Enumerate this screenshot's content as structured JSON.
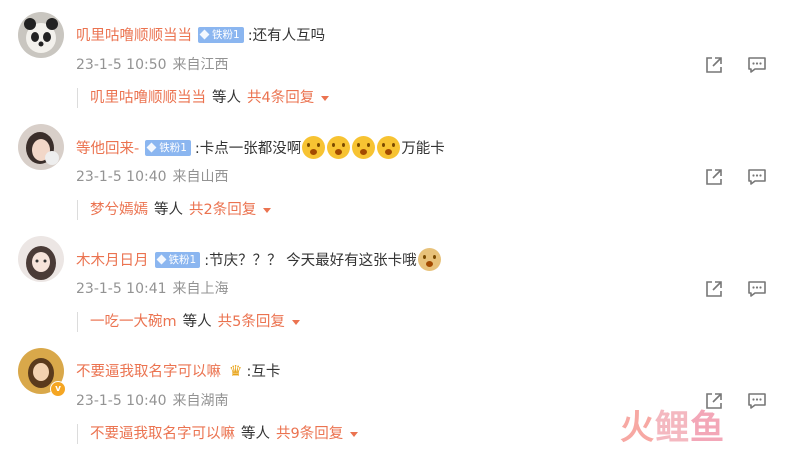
{
  "comments": [
    {
      "username": "叽里咕噜顺顺当当",
      "fan_badge": "铁粉1",
      "text": ":还有人互吗",
      "date": "23-1-5 10:50",
      "location": "来自江西",
      "reply_user": "叽里咕噜顺顺当当",
      "reply_mid": "等人",
      "reply_count": "共4条回复"
    },
    {
      "username": "等他回来-",
      "fan_badge": "铁粉1",
      "text_before": ":卡点一张都没啊",
      "text_after": "万能卡",
      "emoji_count": 4,
      "date": "23-1-5 10:40",
      "location": "来自山西",
      "reply_user": "梦兮嫣嫣",
      "reply_mid": "等人",
      "reply_count": "共2条回复"
    },
    {
      "username": "木木月日月",
      "fan_badge": "铁粉1",
      "text": ":节庆？？？ 今天最好有这张卡哦",
      "date": "23-1-5 10:41",
      "location": "来自上海",
      "reply_user": "一吃一大碗m",
      "reply_mid": "等人",
      "reply_count": "共5条回复"
    },
    {
      "username": "不要逼我取名字可以嘛",
      "text": ":互卡",
      "verified_badge": "v",
      "date": "23-1-5 10:40",
      "location": "来自湖南",
      "reply_user": "不要逼我取名字可以嘛",
      "reply_mid": "等人",
      "reply_count": "共9条回复"
    }
  ],
  "icons": {
    "share": "share-icon",
    "reply": "comment-icon",
    "expand": "triangle-down-icon"
  },
  "watermark": [
    "火",
    "鲤",
    "鱼"
  ],
  "colors": {
    "username": "#eb7350",
    "meta": "#939393",
    "badge": "#8bb6f0"
  }
}
